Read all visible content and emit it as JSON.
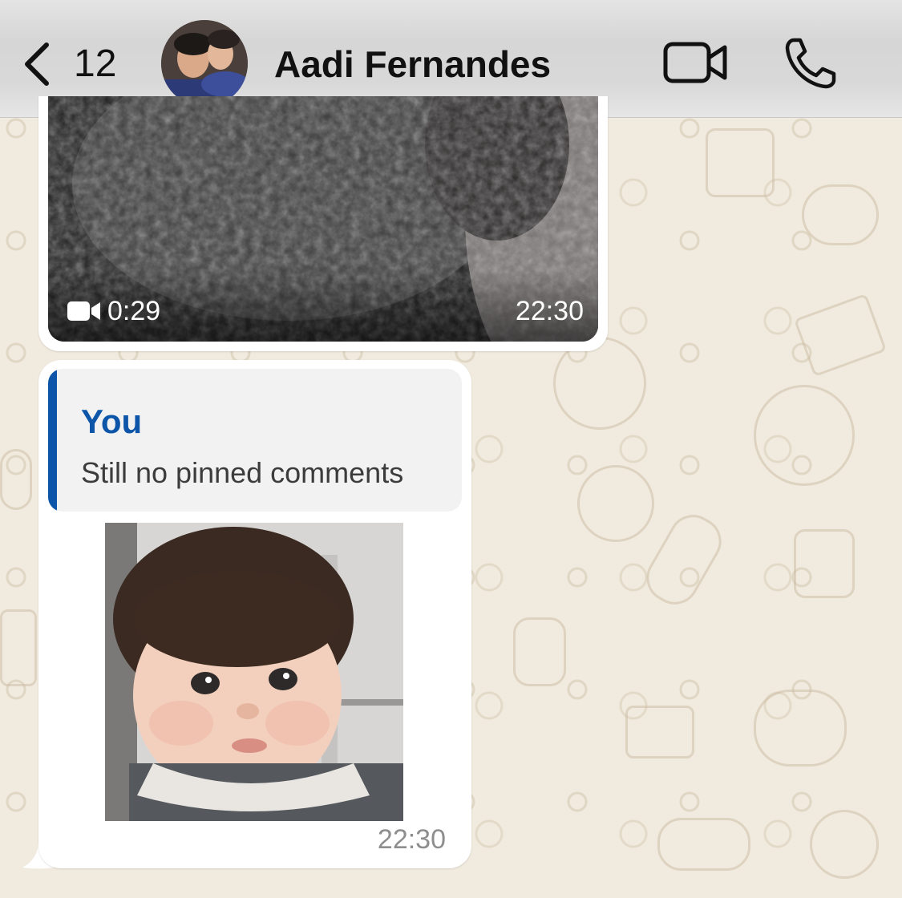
{
  "header": {
    "back_count": "12",
    "contact_name": "Aadi Fernandes",
    "icons": {
      "back": "chevron-left-icon",
      "video_call": "video-camera-icon",
      "voice_call": "phone-icon"
    }
  },
  "messages": [
    {
      "type": "video",
      "duration": "0:29",
      "time": "22:30"
    },
    {
      "type": "reply-sticker",
      "quoted_author": "You",
      "quoted_text": "Still no pinned comments",
      "time": "22:30"
    }
  ],
  "colors": {
    "quote_accent": "#0d55a8",
    "wallpaper": "#f1ebdf",
    "bubble": "#ffffff"
  }
}
